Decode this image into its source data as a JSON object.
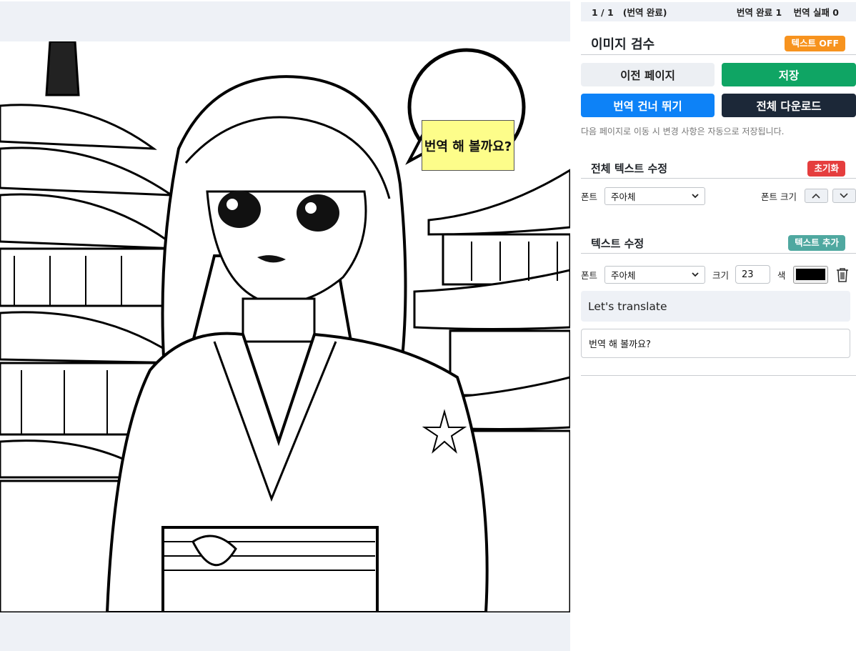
{
  "status": {
    "page_counter": "1 / 1",
    "page_state": "(번역 완료)",
    "done_label": "번역 완료 1",
    "failed_label": "번역 실패 0"
  },
  "review": {
    "title": "이미지 검수",
    "text_toggle": "텍스트 OFF"
  },
  "actions": {
    "prev_label": "이전 페이지",
    "save_label": "저장",
    "skip_label": "번역 건너 뛰기",
    "download_all_label": "전체 다운로드",
    "hint": "다음 페이지로 이동 시 변경 사항은 자동으로 저장됩니다."
  },
  "all_text": {
    "title": "전체 텍스트 수정",
    "reset_label": "초기화",
    "font_label": "폰트",
    "font_value": "주아체",
    "font_size_label": "폰트 크기"
  },
  "text_edit": {
    "title": "텍스트 수정",
    "add_label": "텍스트 추가",
    "font_label": "폰트",
    "font_value": "주아체",
    "size_label": "크기",
    "size_value": "23",
    "color_label": "색",
    "color_value": "#000000",
    "original_text": "Let's translate",
    "translated_text": "번역 해 볼까요?"
  },
  "canvas": {
    "bubble_text": "번역 해 볼까요?"
  },
  "colors": {
    "save": "#0fa564",
    "skip": "#0d82f7",
    "download": "#1c2838",
    "toggle": "#f7931e",
    "reset": "#e53e3e",
    "add": "#4fa8a0",
    "bubble_fill": "#fdfd8a"
  },
  "icons": {
    "size_up": "chevron-up-icon",
    "size_down": "chevron-down-icon",
    "delete": "trash-icon"
  }
}
